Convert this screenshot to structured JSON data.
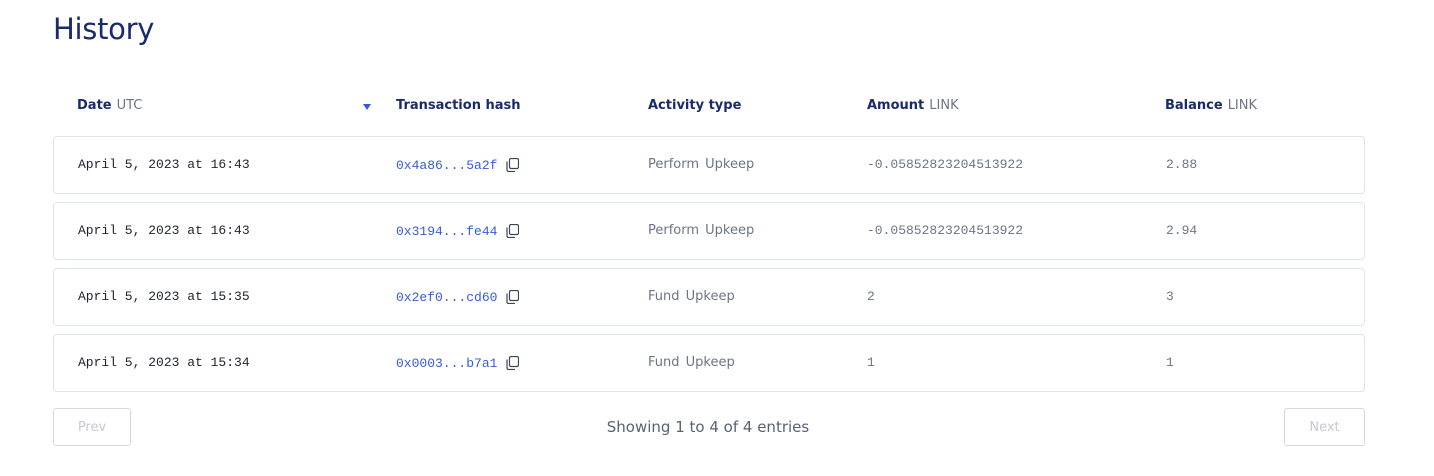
{
  "page": {
    "title": "History"
  },
  "table": {
    "columns": [
      {
        "label": "Date",
        "unit": "UTC"
      },
      {
        "label": "Transaction hash",
        "unit": ""
      },
      {
        "label": "Activity type",
        "unit": ""
      },
      {
        "label": "Amount",
        "unit": "LINK"
      },
      {
        "label": "Balance",
        "unit": "LINK"
      }
    ],
    "sort_icon": "caret-down-icon",
    "copy_icon": "copy-icon",
    "rows": [
      {
        "date": "April 5, 2023 at 16:43",
        "hash": "0x4a86...5a2f",
        "activity": "Perform Upkeep",
        "amount": "-0.05852823204513922",
        "balance": "2.88"
      },
      {
        "date": "April 5, 2023 at 16:43",
        "hash": "0x3194...fe44",
        "activity": "Perform Upkeep",
        "amount": "-0.05852823204513922",
        "balance": "2.94"
      },
      {
        "date": "April 5, 2023 at 15:35",
        "hash": "0x2ef0...cd60",
        "activity": "Fund Upkeep",
        "amount": "2",
        "balance": "3"
      },
      {
        "date": "April 5, 2023 at 15:34",
        "hash": "0x0003...b7a1",
        "activity": "Fund Upkeep",
        "amount": "1",
        "balance": "1"
      }
    ]
  },
  "pagination": {
    "prev_label": "Prev",
    "next_label": "Next",
    "status": "Showing 1 to 4 of 4 entries",
    "prev_enabled": false,
    "next_enabled": false
  },
  "colors": {
    "title": "#1a2b6b",
    "link": "#375bd2",
    "border": "#dfe3ea",
    "muted": "#6c7585"
  }
}
